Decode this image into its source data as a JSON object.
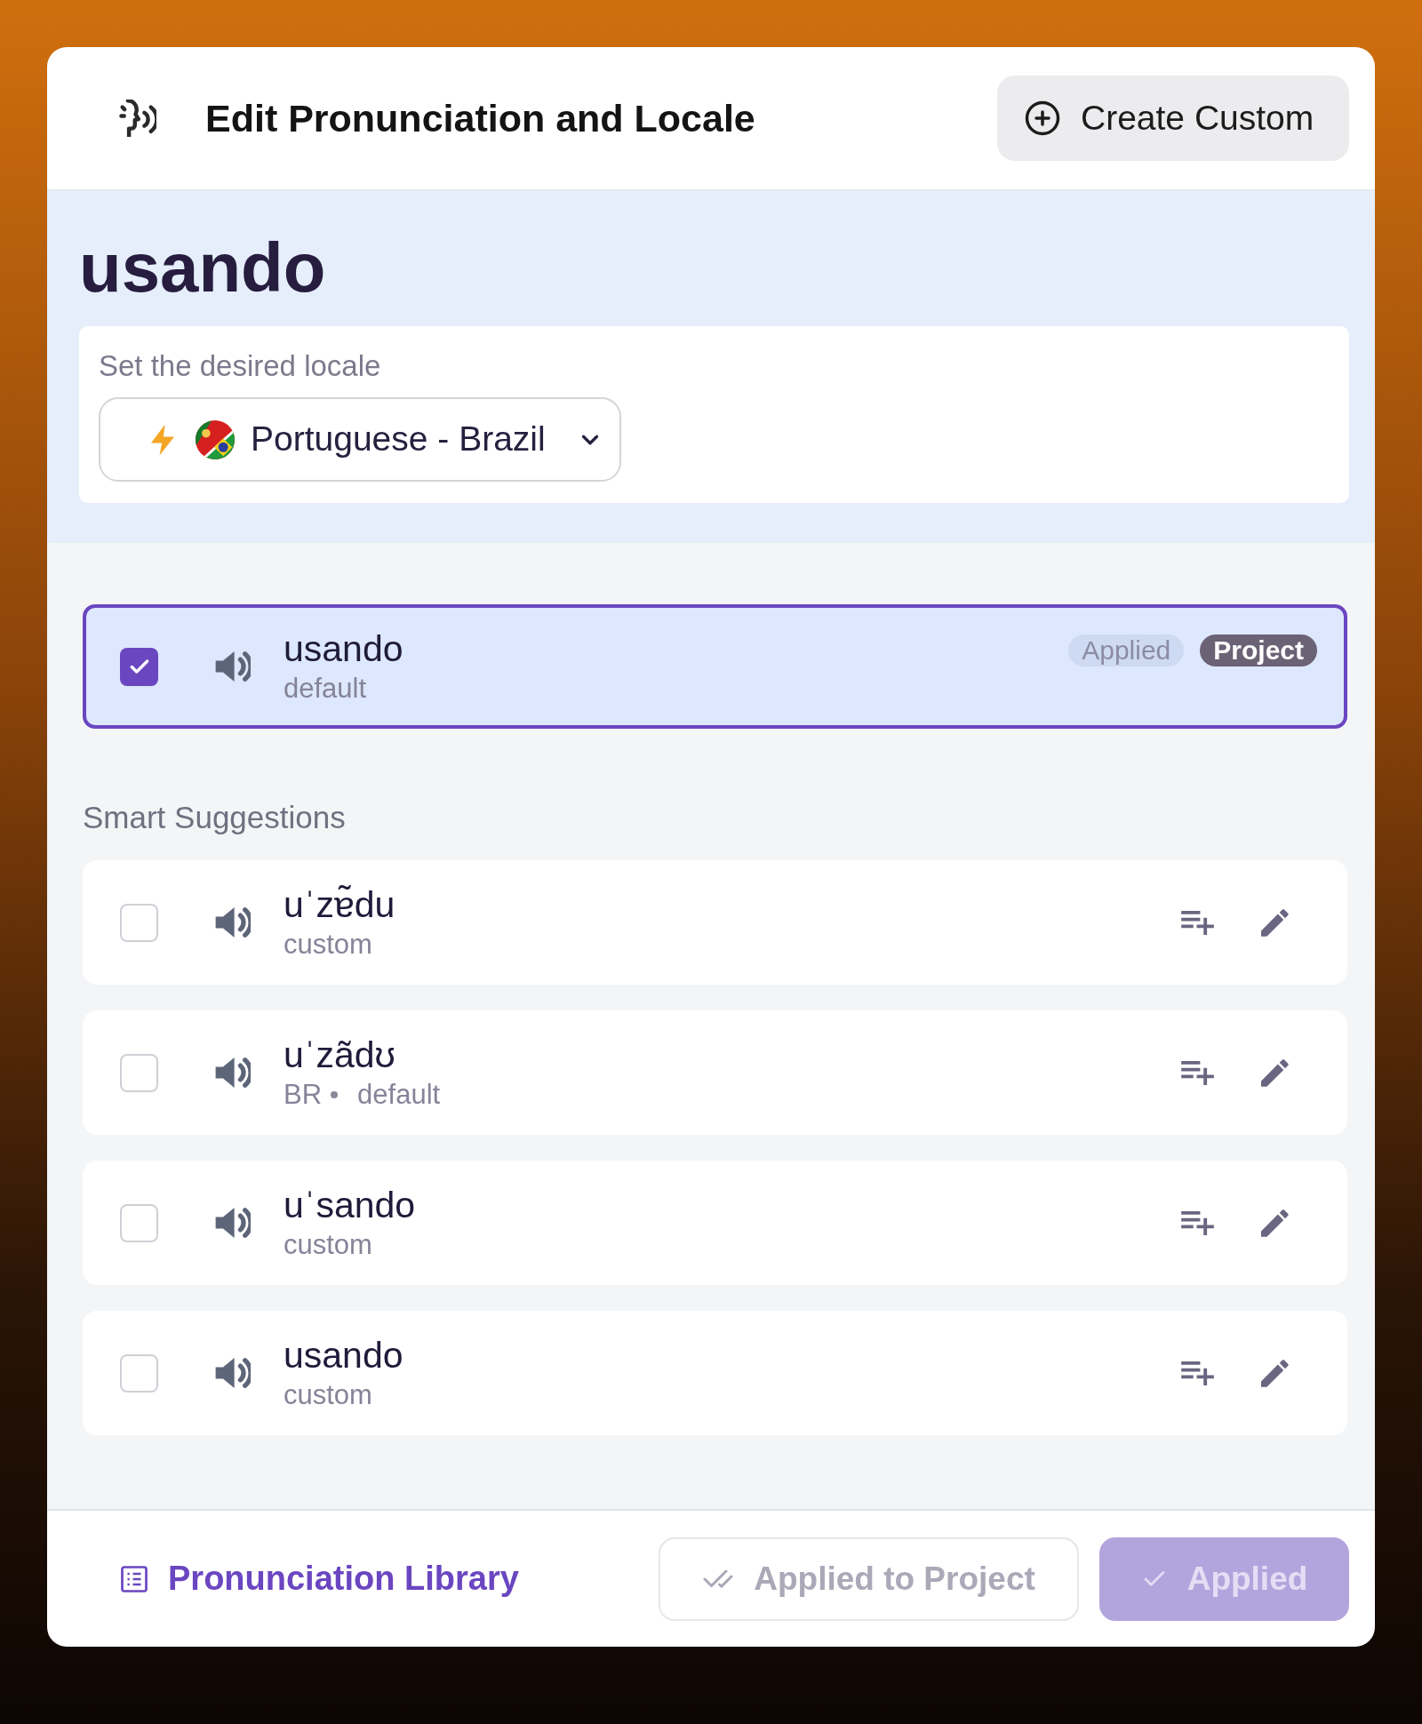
{
  "header": {
    "title": "Edit Pronunciation and Locale",
    "create_button": {
      "label": "Create Custom"
    }
  },
  "word": {
    "text": "usando",
    "locale_label": "Set the desired locale",
    "locale_select": {
      "value": "Portuguese - Brazil"
    }
  },
  "applied_pronunciation": {
    "checked": true,
    "text": "usando",
    "tags": [
      "default"
    ],
    "badges": [
      {
        "label": "Applied",
        "kind": "status"
      },
      {
        "label": "Project",
        "kind": "scope"
      }
    ]
  },
  "suggestions": {
    "heading": "Smart Suggestions",
    "items": [
      {
        "checked": false,
        "text": "uˈzɐ̃du",
        "tags": [
          "custom"
        ]
      },
      {
        "checked": false,
        "text": "uˈzãdʊ",
        "tags": [
          "BR",
          "default"
        ]
      },
      {
        "checked": false,
        "text": "uˈsando",
        "tags": [
          "custom"
        ]
      },
      {
        "checked": false,
        "text": "usando",
        "tags": [
          "custom"
        ]
      }
    ]
  },
  "footer": {
    "library_link": "Pronunciation Library",
    "buttons": [
      {
        "label": "Applied to Project",
        "kind": "outline",
        "disabled": true
      },
      {
        "label": "Applied",
        "kind": "primary",
        "disabled": true
      }
    ]
  }
}
